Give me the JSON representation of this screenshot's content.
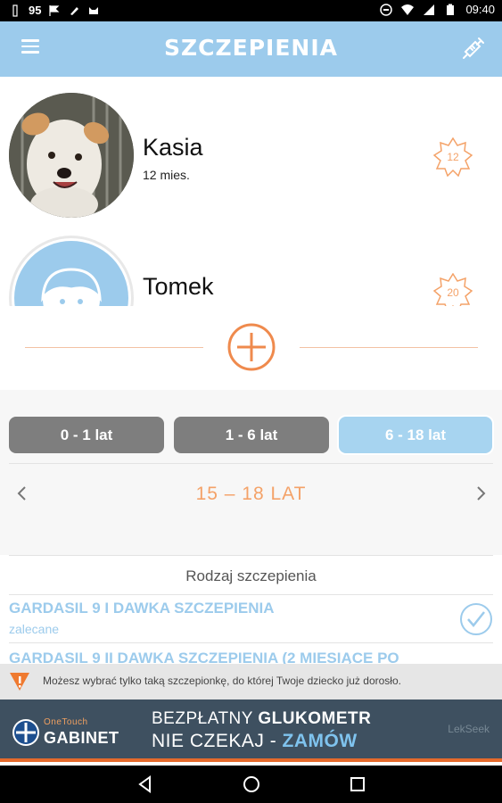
{
  "status_bar": {
    "battery_level_text": "95",
    "time": "09:40"
  },
  "app_bar": {
    "title": "SZCZEPIENIA",
    "menu_icon": "hamburger-menu-icon",
    "action_icon": "syringe-icon"
  },
  "profiles": [
    {
      "name": "Kasia",
      "age": "12 mies.",
      "badge": "12",
      "avatar": "dog-photo"
    },
    {
      "name": "Tomek",
      "age": "",
      "badge": "20",
      "avatar": "default-child-avatar"
    }
  ],
  "add_profile_icon": "plus-circle-icon",
  "age_tabs": [
    {
      "label": "0 - 1 lat",
      "active": false
    },
    {
      "label": "1 - 6 lat",
      "active": false
    },
    {
      "label": "6 - 18 lat",
      "active": true
    }
  ],
  "range": {
    "label": "15 – 18 LAT"
  },
  "list": {
    "header": "Rodzaj szczepienia",
    "items": [
      {
        "title": "GARDASIL 9 I DAWKA SZCZEPIENIA",
        "subtitle": "zalecane",
        "checked": true
      },
      {
        "title": "GARDASIL 9 II DAWKA SZCZEPIENIA (2 MIESIĄCE PO",
        "subtitle": "",
        "checked": false
      }
    ]
  },
  "notice": {
    "text": "Możesz wybrać tylko taką szczepionkę, do której Twoje dziecko już dorosło."
  },
  "ad": {
    "brand_top": "OneTouch",
    "brand": "GABINET",
    "line1_pre": "BEZPŁATNY ",
    "line1_bold": "GLUKOMETR",
    "line2_pre": "NIE CZEKAJ - ",
    "line2_accent": "ZAMÓW",
    "sponsor": "LekSeek"
  },
  "colors": {
    "primary": "#9ccbec",
    "accent_orange": "#f4a268",
    "tab_inactive": "#7e7e7e",
    "tab_active": "#a7d4f0",
    "ad_bg": "#3e5060"
  }
}
